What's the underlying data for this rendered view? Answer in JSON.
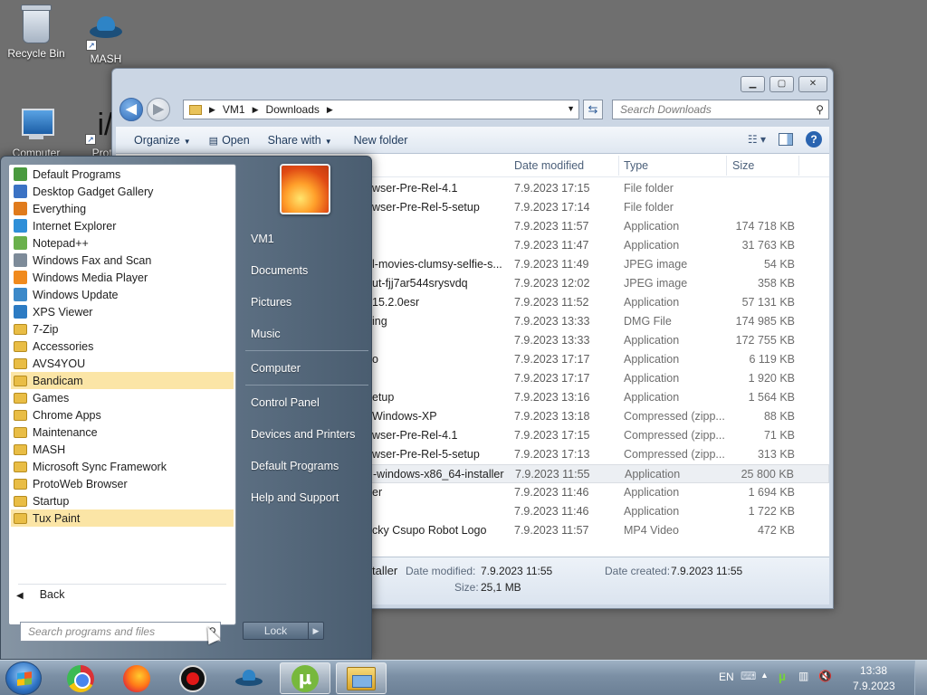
{
  "desktop": {
    "icons": [
      {
        "label": "Recycle Bin",
        "icon": "recycle-bin-icon"
      },
      {
        "label": "MASH",
        "icon": "ufo-icon"
      },
      {
        "label": "Computer",
        "icon": "computer-icon"
      },
      {
        "label": "Proto",
        "icon": "protoweb-icon"
      }
    ]
  },
  "explorer": {
    "breadcrumb": [
      "VM1",
      "Downloads"
    ],
    "search_placeholder": "Search Downloads",
    "toolbar": {
      "organize": "Organize",
      "open": "Open",
      "share_with": "Share with",
      "new_folder": "New folder"
    },
    "columns": {
      "date": "Date modified",
      "type": "Type",
      "size": "Size"
    },
    "files": [
      {
        "name": "wser-Pre-Rel-4.1",
        "date": "7.9.2023 17:15",
        "type": "File folder",
        "size": ""
      },
      {
        "name": "wser-Pre-Rel-5-setup",
        "date": "7.9.2023 17:14",
        "type": "File folder",
        "size": ""
      },
      {
        "name": "",
        "date": "7.9.2023 11:57",
        "type": "Application",
        "size": "174 718 KB"
      },
      {
        "name": "",
        "date": "7.9.2023 11:47",
        "type": "Application",
        "size": "31 763 KB"
      },
      {
        "name": "l-movies-clumsy-selfie-s...",
        "date": "7.9.2023 11:49",
        "type": "JPEG image",
        "size": "54 KB"
      },
      {
        "name": "ut-fjj7ar544srysvdq",
        "date": "7.9.2023 12:02",
        "type": "JPEG image",
        "size": "358 KB"
      },
      {
        "name": "15.2.0esr",
        "date": "7.9.2023 11:52",
        "type": "Application",
        "size": "57 131 KB"
      },
      {
        "name": "ing",
        "date": "7.9.2023 13:33",
        "type": "DMG File",
        "size": "174 985 KB"
      },
      {
        "name": "",
        "date": "7.9.2023 13:33",
        "type": "Application",
        "size": "172 755 KB"
      },
      {
        "name": "o",
        "date": "7.9.2023 17:17",
        "type": "Application",
        "size": "6 119 KB"
      },
      {
        "name": "",
        "date": "7.9.2023 17:17",
        "type": "Application",
        "size": "1 920 KB"
      },
      {
        "name": "etup",
        "date": "7.9.2023 13:16",
        "type": "Application",
        "size": "1 564 KB"
      },
      {
        "name": "Windows-XP",
        "date": "7.9.2023 13:18",
        "type": "Compressed (zipp...",
        "size": "88 KB"
      },
      {
        "name": "wser-Pre-Rel-4.1",
        "date": "7.9.2023 17:15",
        "type": "Compressed (zipp...",
        "size": "71 KB"
      },
      {
        "name": "wser-Pre-Rel-5-setup",
        "date": "7.9.2023 17:13",
        "type": "Compressed (zipp...",
        "size": "313 KB"
      },
      {
        "name": "-windows-x86_64-installer",
        "date": "7.9.2023 11:55",
        "type": "Application",
        "size": "25 800 KB"
      },
      {
        "name": "er",
        "date": "7.9.2023 11:46",
        "type": "Application",
        "size": "1 694 KB"
      },
      {
        "name": "",
        "date": "7.9.2023 11:46",
        "type": "Application",
        "size": "1 722 KB"
      },
      {
        "name": "cky Csupo Robot Logo",
        "date": "7.9.2023 11:57",
        "type": "MP4 Video",
        "size": "472 KB"
      }
    ],
    "details": {
      "name": "taller",
      "date_modified_label": "Date modified:",
      "date_modified": "7.9.2023 11:55",
      "date_created_label": "Date created:",
      "date_created": "7.9.2023 11:55",
      "size_label": "Size:",
      "size": "25,1 MB"
    }
  },
  "start_menu": {
    "programs": [
      {
        "label": "Default Programs",
        "icon": "default-programs-icon",
        "color": "#4a9a3f"
      },
      {
        "label": "Desktop Gadget Gallery",
        "icon": "gadget-icon",
        "color": "#3b72c4"
      },
      {
        "label": "Everything",
        "icon": "search-icon",
        "color": "#e07b1c"
      },
      {
        "label": "Internet Explorer",
        "icon": "ie-icon",
        "color": "#2f8fd8"
      },
      {
        "label": "Notepad++",
        "icon": "notepad-icon",
        "color": "#6ab04c"
      },
      {
        "label": "Windows Fax and Scan",
        "icon": "fax-icon",
        "color": "#7d8b99"
      },
      {
        "label": "Windows Media Player",
        "icon": "media-player-icon",
        "color": "#f08a1d"
      },
      {
        "label": "Windows Update",
        "icon": "update-icon",
        "color": "#3c89c9"
      },
      {
        "label": "XPS Viewer",
        "icon": "xps-icon",
        "color": "#2c7bc3"
      },
      {
        "label": "7-Zip",
        "icon": "folder-icon"
      },
      {
        "label": "Accessories",
        "icon": "folder-icon"
      },
      {
        "label": "AVS4YOU",
        "icon": "folder-icon"
      },
      {
        "label": "Bandicam",
        "icon": "folder-icon",
        "highlight": true
      },
      {
        "label": "Games",
        "icon": "folder-icon"
      },
      {
        "label": "Chrome Apps",
        "icon": "folder-icon"
      },
      {
        "label": "Maintenance",
        "icon": "folder-icon"
      },
      {
        "label": "MASH",
        "icon": "folder-icon"
      },
      {
        "label": "Microsoft Sync Framework",
        "icon": "folder-icon"
      },
      {
        "label": "ProtoWeb Browser",
        "icon": "folder-icon"
      },
      {
        "label": "Startup",
        "icon": "folder-icon"
      },
      {
        "label": "Tux Paint",
        "icon": "folder-icon",
        "highlight": true
      }
    ],
    "back_label": "Back",
    "search_placeholder": "Search programs and files",
    "right_items": [
      "VM1",
      "Documents",
      "Pictures",
      "Music",
      "Computer",
      "Control Panel",
      "Devices and Printers",
      "Default Programs",
      "Help and Support"
    ],
    "lock_label": "Lock"
  },
  "taskbar": {
    "apps": [
      "chrome-icon",
      "firefox-icon",
      "record-icon",
      "mash-icon",
      "utorrent-icon",
      "explorer-icon"
    ],
    "lang": "EN",
    "time": "13:38",
    "date": "7.9.2023"
  }
}
